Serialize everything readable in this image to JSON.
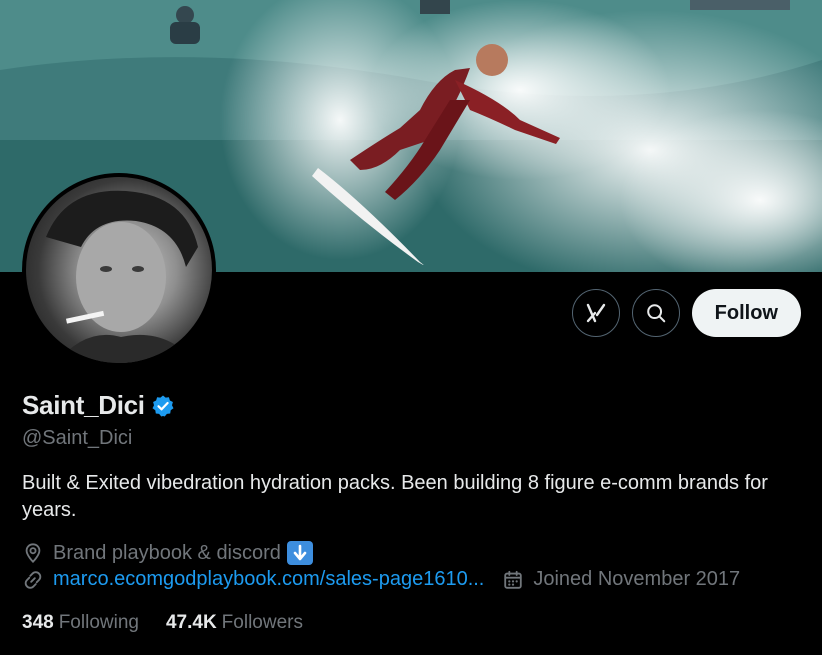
{
  "banner": {
    "alt": "surfer riding wave"
  },
  "profile": {
    "display_name": "Saint_Dici",
    "verified": true,
    "handle": "@Saint_Dici",
    "bio": "Built & Exited vibedration hydration packs. Been building 8 figure e-comm brands for years.",
    "location": "Brand playbook & discord",
    "location_emoji": "down-arrow-emoji",
    "website": "marco.ecomgodplaybook.com/sales-page1610...",
    "joined": "Joined November 2017"
  },
  "actions": {
    "grok_icon": "grok-icon",
    "search_icon": "search-icon",
    "follow_label": "Follow"
  },
  "stats": {
    "following_count": "348",
    "following_label": "Following",
    "followers_count": "47.4K",
    "followers_label": "Followers"
  },
  "colors": {
    "accent": "#1d9bf0",
    "muted": "#71767b",
    "text": "#e7e9ea",
    "background": "#000000"
  }
}
